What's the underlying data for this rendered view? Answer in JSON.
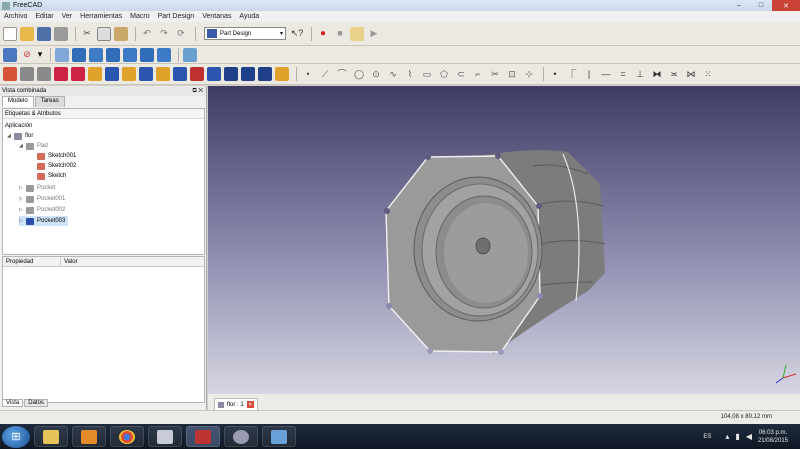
{
  "window": {
    "title": "FreeCAD",
    "minimize": "–",
    "maximize": "□",
    "close": "✕"
  },
  "menubar": [
    "Archivo",
    "Editar",
    "Ver",
    "Herramientas",
    "Macro",
    "Part Design",
    "Ventanas",
    "Ayuda"
  ],
  "toolbar": {
    "workbench": "Part Design"
  },
  "combo_view": {
    "title": "Vista combinada",
    "header_buttons": "⧉ ✕",
    "tabs": [
      "Modelo",
      "Tareas"
    ],
    "tree_header": "Etiquetas & Atributos",
    "tree": {
      "root": "Aplicación",
      "document": "flor",
      "pad": "Pad",
      "sketches": [
        "Sketch001",
        "Sketch002",
        "Sketch"
      ],
      "pockets": [
        "Pocket",
        "Pocket001",
        "Pocket002",
        "Pocket003"
      ]
    },
    "property_columns": [
      "Propiedad",
      "Valor"
    ],
    "bottom_tabs": [
      "Vista",
      "Datos"
    ]
  },
  "document_tab": {
    "label": "flor : 1"
  },
  "statusbar": {
    "coords": "104,08 x 80,12 mm"
  },
  "taskbar": {
    "language": "ES",
    "time": "06:03 p.m.",
    "date": "21/08/2015"
  },
  "colors": {
    "view_top": "#3f3c63",
    "view_bottom": "#d6d6e2",
    "part_gray": "#8f8f8f",
    "selected_row": "#cfe3fb"
  }
}
